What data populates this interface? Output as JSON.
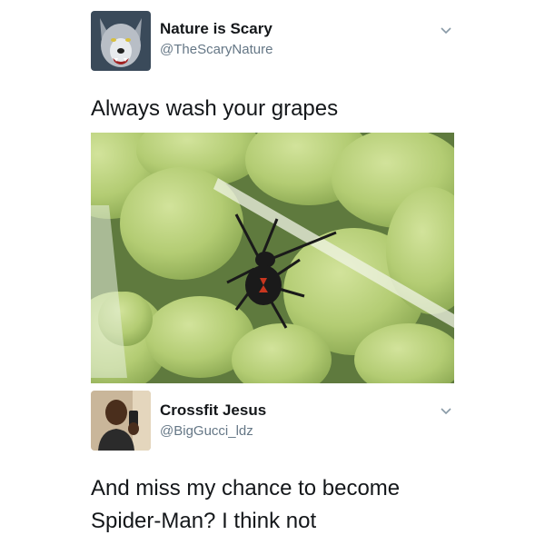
{
  "tweets": [
    {
      "display_name": "Nature is Scary",
      "handle": "@TheScaryNature",
      "text": "Always wash your grapes",
      "avatar_icon": "wolf-avatar-icon",
      "menu_icon": "chevron-down-icon"
    },
    {
      "display_name": "Crossfit Jesus",
      "handle": "@BigGucci_ldz",
      "text_lines": [
        "And miss my chance to become",
        "Spider-Man? I think not"
      ],
      "avatar_icon": "person-avatar-icon",
      "menu_icon": "chevron-down-icon"
    }
  ],
  "colors": {
    "text": "#14171a",
    "secondary_text": "#657786",
    "chevron": "#8899a6",
    "grape": "#b9d179",
    "spider": "#1a1a1a",
    "spider_mark": "#c8361f"
  }
}
